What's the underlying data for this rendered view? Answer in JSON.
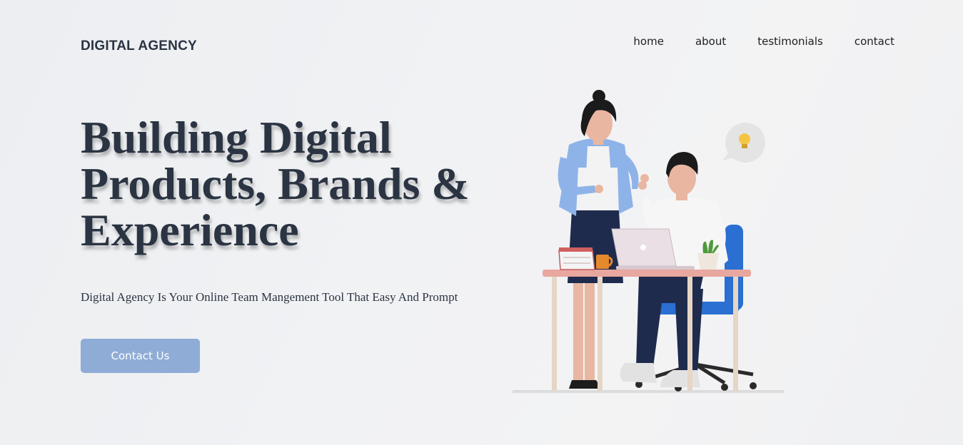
{
  "header": {
    "logo": "DIGITAL AGENCY",
    "nav": [
      {
        "label": "home"
      },
      {
        "label": "about"
      },
      {
        "label": "testimonials"
      },
      {
        "label": "contact"
      }
    ]
  },
  "hero": {
    "headline_lines": [
      "Building Digital",
      "Products, Brands &",
      "Experience"
    ],
    "subtitle": "Digital Agency Is Your Online Team Mangement Tool That Easy And Prompt",
    "cta_label": "Contact Us",
    "illustration": "two-people-working-at-desk-with-laptop",
    "illustration_icons": [
      "calendar-icon",
      "mug-icon",
      "laptop-icon",
      "plant-icon",
      "lightbulb-icon"
    ]
  },
  "colors": {
    "text_dark": "#2b3442",
    "button_bg": "#8eacd6",
    "button_text": "#ffffff",
    "background": "#f0f1f3"
  }
}
